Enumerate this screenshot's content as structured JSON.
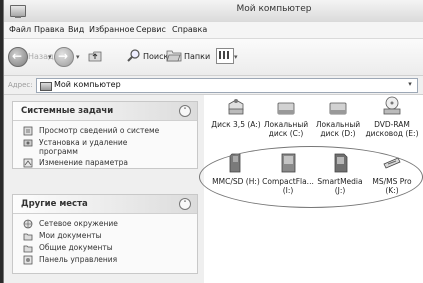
{
  "window": {
    "title": "Мой компьютер"
  },
  "menu": [
    {
      "label": "Файл"
    },
    {
      "label": "Правка"
    },
    {
      "label": "Вид"
    },
    {
      "label": "Избранное"
    },
    {
      "label": "Сервис"
    },
    {
      "label": "Справка"
    }
  ],
  "toolbar": {
    "back_label": "Назад",
    "search_label": "Поиск",
    "folders_label": "Папки"
  },
  "address": {
    "label": "Адрес:",
    "value": "Мой компьютер"
  },
  "system_tasks": {
    "title": "Системные задачи",
    "items": [
      {
        "label": "Просмотр сведений о системе"
      },
      {
        "label": "Установка и удаление программ"
      },
      {
        "label": "Изменение параметра"
      }
    ]
  },
  "other_places": {
    "title": "Другие места",
    "items": [
      {
        "label": "Сетевое окружение"
      },
      {
        "label": "Мои документы"
      },
      {
        "label": "Общие документы"
      },
      {
        "label": "Панель управления"
      }
    ]
  },
  "drives_row1": [
    {
      "line1": "Диск 3,5 (A:)",
      "line2": ""
    },
    {
      "line1": "Локальный",
      "line2": "диск (C:)"
    },
    {
      "line1": "Локальный",
      "line2": "диск (D:)"
    },
    {
      "line1": "DVD-RAM",
      "line2": "дисковод (E:)"
    }
  ],
  "drives_row2": [
    {
      "line1": "MMC/SD (H:)",
      "line2": ""
    },
    {
      "line1": "CompactFla...",
      "line2": "(I:)"
    },
    {
      "line1": "SmartMedia",
      "line2": "(J:)"
    },
    {
      "line1": "MS/MS Pro",
      "line2": "(K:)"
    }
  ]
}
